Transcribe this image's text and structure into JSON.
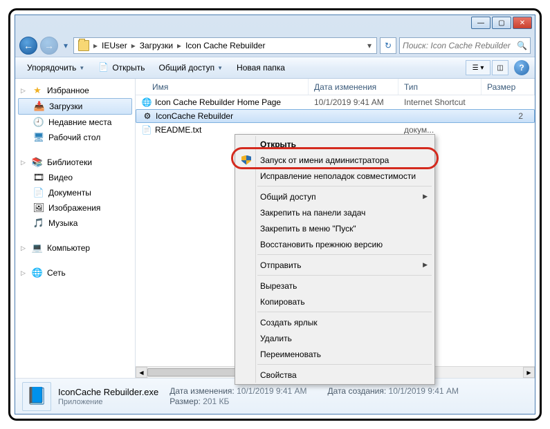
{
  "breadcrumbs": {
    "drop_prefix": "▾",
    "items": [
      "IEUser",
      "Загрузки",
      "Icon Cache Rebuilder"
    ]
  },
  "search": {
    "placeholder": "Поиск: Icon Cache Rebuilder"
  },
  "toolbar": {
    "organize": "Упорядочить",
    "open": "Открыть",
    "share": "Общий доступ",
    "newfolder": "Новая папка"
  },
  "sidebar": {
    "favorites": {
      "label": "Избранное",
      "items": [
        {
          "label": "Загрузки",
          "icon": "download"
        },
        {
          "label": "Недавние места",
          "icon": "recent"
        },
        {
          "label": "Рабочий стол",
          "icon": "desktop"
        }
      ]
    },
    "libraries": {
      "label": "Библиотеки",
      "items": [
        {
          "label": "Видео",
          "icon": "video"
        },
        {
          "label": "Документы",
          "icon": "docs"
        },
        {
          "label": "Изображения",
          "icon": "images"
        },
        {
          "label": "Музыка",
          "icon": "music"
        }
      ]
    },
    "computer": {
      "label": "Компьютер"
    },
    "network": {
      "label": "Сеть"
    }
  },
  "columns": {
    "name": "Имя",
    "date": "Дата изменения",
    "type": "Тип",
    "size": "Размер"
  },
  "files": [
    {
      "name": "Icon Cache Rebuilder Home Page",
      "date": "10/1/2019 9:41 AM",
      "type": "Internet Shortcut",
      "size": "",
      "icon": "url"
    },
    {
      "name": "IconCache Rebuilder",
      "date": "",
      "type": "",
      "size": "2",
      "icon": "exe",
      "selected": true
    },
    {
      "name": "README.txt",
      "date": "",
      "type": "докум...",
      "size": "",
      "icon": "txt"
    }
  ],
  "context_menu": [
    {
      "label": "Открыть",
      "bold": true
    },
    {
      "label": "Запуск от имени администратора",
      "icon": "shield",
      "highlight": true
    },
    {
      "label": "Исправление неполадок совместимости"
    },
    {
      "sep": true
    },
    {
      "label": "Общий доступ",
      "submenu": true
    },
    {
      "label": "Закрепить на панели задач"
    },
    {
      "label": "Закрепить в меню \"Пуск\""
    },
    {
      "label": "Восстановить прежнюю версию"
    },
    {
      "sep": true
    },
    {
      "label": "Отправить",
      "submenu": true
    },
    {
      "sep": true
    },
    {
      "label": "Вырезать"
    },
    {
      "label": "Копировать"
    },
    {
      "sep": true
    },
    {
      "label": "Создать ярлык"
    },
    {
      "label": "Удалить"
    },
    {
      "label": "Переименовать"
    },
    {
      "sep": true
    },
    {
      "label": "Свойства"
    }
  ],
  "details": {
    "name": "IconCache Rebuilder.exe",
    "type": "Приложение",
    "date_label": "Дата изменения:",
    "date": "10/1/2019 9:41 AM",
    "size_label": "Размер:",
    "size": "201 КБ",
    "created_label": "Дата создания:",
    "created": "10/1/2019 9:41 AM"
  }
}
